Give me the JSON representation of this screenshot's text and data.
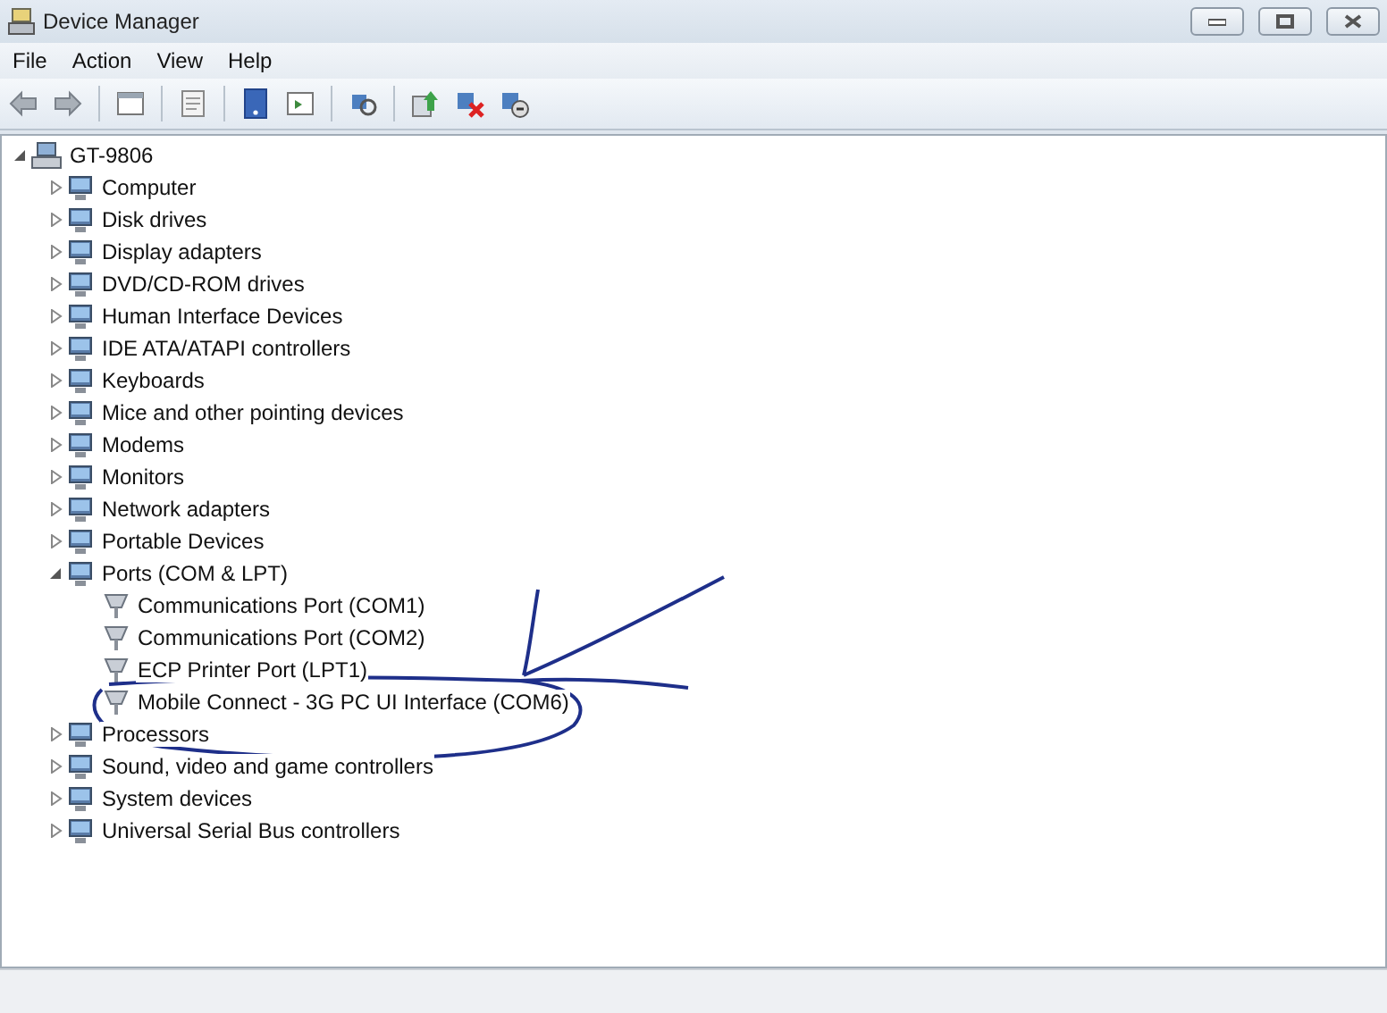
{
  "window": {
    "title": "Device Manager"
  },
  "menu": [
    "File",
    "Action",
    "View",
    "Help"
  ],
  "tree": [
    {
      "label": "GT-9806",
      "expanded": true,
      "children": [
        {
          "label": "Computer",
          "expanded": false
        },
        {
          "label": "Disk drives",
          "expanded": false
        },
        {
          "label": "Display adapters",
          "expanded": false
        },
        {
          "label": "DVD/CD-ROM drives",
          "expanded": false
        },
        {
          "label": "Human Interface Devices",
          "expanded": false
        },
        {
          "label": "IDE ATA/ATAPI controllers",
          "expanded": false
        },
        {
          "label": "Keyboards",
          "expanded": false
        },
        {
          "label": "Mice and other pointing devices",
          "expanded": false
        },
        {
          "label": "Modems",
          "expanded": false
        },
        {
          "label": "Monitors",
          "expanded": false
        },
        {
          "label": "Network adapters",
          "expanded": false
        },
        {
          "label": "Portable Devices",
          "expanded": false
        },
        {
          "label": "Ports (COM & LPT)",
          "expanded": true,
          "children": [
            {
              "label": "Communications Port (COM1)"
            },
            {
              "label": "Communications Port (COM2)"
            },
            {
              "label": "ECP Printer Port (LPT1)"
            },
            {
              "label": "Mobile Connect - 3G PC UI Interface (COM6)"
            }
          ]
        },
        {
          "label": "Processors",
          "expanded": false
        },
        {
          "label": "Sound, video and game controllers",
          "expanded": false
        },
        {
          "label": "System devices",
          "expanded": false
        },
        {
          "label": "Universal Serial Bus controllers",
          "expanded": false
        }
      ]
    }
  ]
}
